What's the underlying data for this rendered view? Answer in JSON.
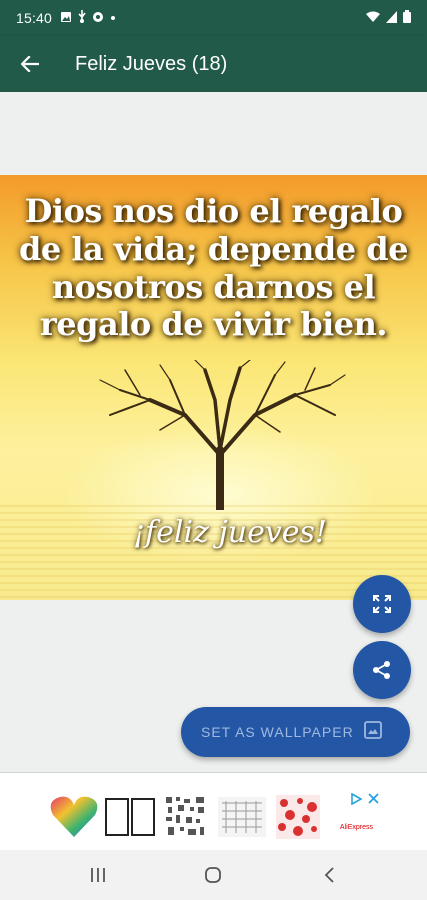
{
  "status_bar": {
    "time": "15:40",
    "left_icons": [
      "gallery-icon",
      "usb-icon",
      "settings-icon",
      "dot-icon"
    ],
    "right_icons": [
      "wifi-icon",
      "signal-icon",
      "battery-icon"
    ]
  },
  "app_bar": {
    "title": "Feliz Jueves (18)",
    "back_icon": "arrow-back-icon"
  },
  "image": {
    "quote_lines": [
      "Dios nos dio el regalo",
      "de la vida; depende de",
      "nosotros darnos el",
      "regalo de vivir bien."
    ],
    "subtitle": "¡feliz jueves!"
  },
  "actions": {
    "fullscreen_icon": "fullscreen-icon",
    "share_icon": "share-icon",
    "set_wallpaper_label": "SET AS WALLPAPER",
    "wallpaper_icon": "wallpaper-icon"
  },
  "ad": {
    "brand": "AliExpress",
    "icons": [
      "ad-choices-icon",
      "close-icon"
    ]
  },
  "nav_bar": {
    "icons": [
      "recent-apps-icon",
      "home-icon",
      "back-icon"
    ]
  },
  "colors": {
    "app_bar": "#215a48",
    "fab": "#2357a5",
    "fab_label": "#9fb8e0",
    "background": "#eef0ef"
  }
}
